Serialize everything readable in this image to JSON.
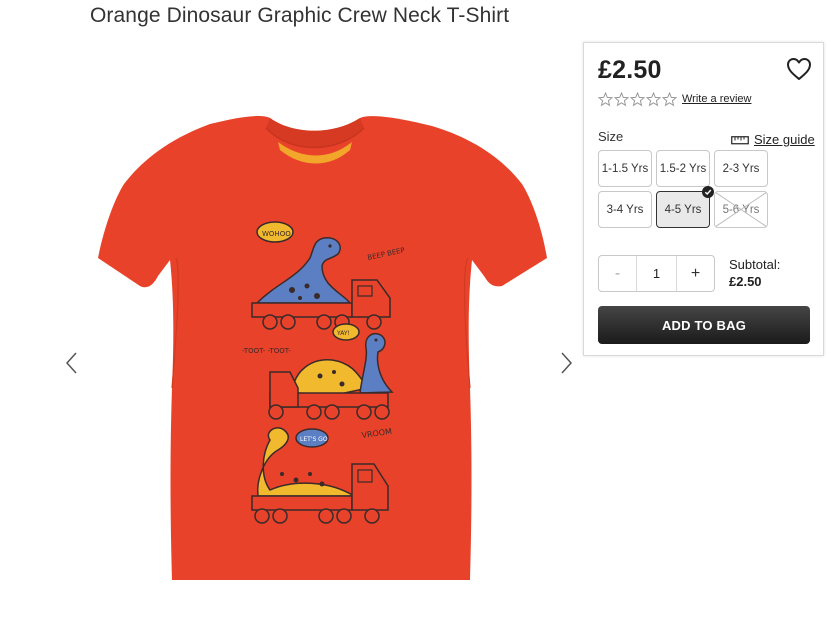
{
  "product": {
    "title": "Orange Dinosaur Graphic Crew Neck T-Shirt",
    "image_alt": "Orange Dinosaur Graphic Crew Neck T-Shirt",
    "graphic_texts": [
      "WOHOO",
      "BEEP BEEP",
      "-TOOT- -TOOT-",
      "YAY!",
      "LET'S GO",
      "VROOM"
    ]
  },
  "gallery": {
    "prev_icon": "chevron-left-icon",
    "next_icon": "chevron-right-icon"
  },
  "purchase": {
    "price": "£2.50",
    "wishlist_icon": "heart-icon",
    "rating_stars": 0,
    "rating_max": 5,
    "review_link": "Write a review",
    "size_label": "Size",
    "size_guide_label": "Size guide",
    "size_guide_icon": "ruler-icon",
    "sizes": [
      {
        "label": "1-1.5 Yrs",
        "state": "available"
      },
      {
        "label": "1.5-2 Yrs",
        "state": "available"
      },
      {
        "label": "2-3 Yrs",
        "state": "available"
      },
      {
        "label": "3-4 Yrs",
        "state": "available"
      },
      {
        "label": "4-5 Yrs",
        "state": "selected"
      },
      {
        "label": "5-6 Yrs",
        "state": "unavailable"
      }
    ],
    "quantity": "1",
    "minus_label": "-",
    "plus_label": "+",
    "subtotal_label": "Subtotal:",
    "subtotal_value": "£2.50",
    "add_to_bag": "ADD TO BAG"
  },
  "colors": {
    "shirt": "#e8432a",
    "collar_inner": "#f2a72a",
    "dino_blue": "#5c7fc4",
    "dino_yellow": "#f0b92e",
    "ink": "#3a2a2a",
    "button_dark": "#222222"
  }
}
